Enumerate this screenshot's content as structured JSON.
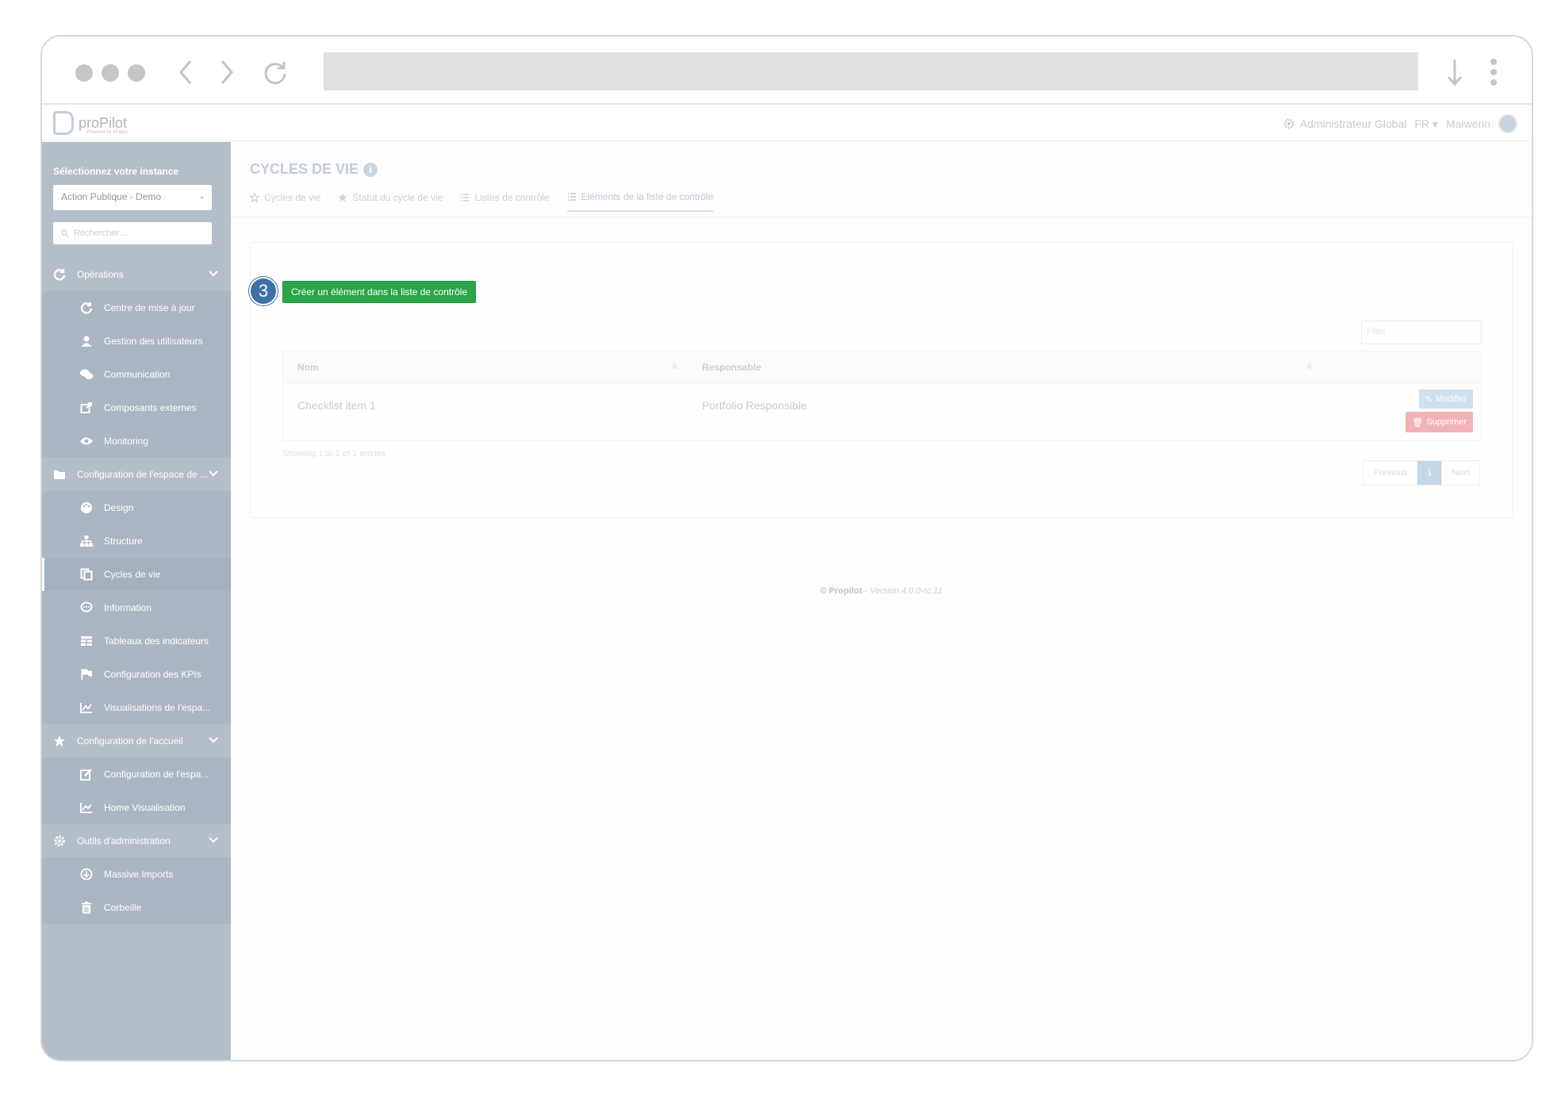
{
  "app": {
    "logo_text": "proPilot",
    "logo_sub": "Powered by eFakta"
  },
  "topbar": {
    "role": "Administrateur Global",
    "lang": "FR",
    "user": "Maiwenn"
  },
  "sidebar": {
    "instance_title": "Sélectionnez votre instance",
    "instance_value": "Action Publique - Demo",
    "search_placeholder": "Rechercher ...",
    "items": [
      {
        "label": "Opérations",
        "type": "section",
        "icon": "refresh-icon"
      },
      {
        "label": "Centre de mise à jour",
        "type": "child",
        "icon": "refresh-icon"
      },
      {
        "label": "Gestion des utilisateurs",
        "type": "child",
        "icon": "user-icon"
      },
      {
        "label": "Communication",
        "type": "child",
        "icon": "comments-icon"
      },
      {
        "label": "Composants externes",
        "type": "child",
        "icon": "share-icon"
      },
      {
        "label": "Monitoring",
        "type": "child",
        "icon": "eye-icon"
      },
      {
        "label": "Configuration de l'espace de ...",
        "type": "section",
        "icon": "folder-icon"
      },
      {
        "label": "Design",
        "type": "child",
        "icon": "palette-icon"
      },
      {
        "label": "Structure",
        "type": "child",
        "icon": "sitemap-icon"
      },
      {
        "label": "Cycles de vie",
        "type": "child",
        "icon": "copy-icon",
        "active": true
      },
      {
        "label": "Information",
        "type": "child",
        "icon": "comment-icon"
      },
      {
        "label": "Tableaux des indicateurs",
        "type": "child",
        "icon": "table-icon"
      },
      {
        "label": "Configuration des KPIs",
        "type": "child",
        "icon": "flag-icon"
      },
      {
        "label": "Visualisations de l'espa...",
        "type": "child",
        "icon": "chart-icon"
      },
      {
        "label": "Configuration de l'accueil",
        "type": "section",
        "icon": "star-icon"
      },
      {
        "label": "Configuration de l'espa...",
        "type": "child",
        "icon": "edit-icon"
      },
      {
        "label": "Home Visualisation",
        "type": "child",
        "icon": "chart-icon"
      },
      {
        "label": "Outils d'administration",
        "type": "section",
        "icon": "gear-icon"
      },
      {
        "label": "Massive Imports",
        "type": "child",
        "icon": "download-circle-icon"
      },
      {
        "label": "Corbeille",
        "type": "child",
        "icon": "trash-icon"
      }
    ]
  },
  "main": {
    "title": "CYCLES DE VIE",
    "tabs": [
      {
        "label": "Cycles de vie",
        "icon": "star-outline-icon"
      },
      {
        "label": "Statut du cycle de vie",
        "icon": "star-icon"
      },
      {
        "label": "Listes de contrôle",
        "icon": "list-icon"
      },
      {
        "label": "Eléments de la liste de contrôle",
        "icon": "list-icon",
        "active": true
      }
    ],
    "step_number": "3",
    "create_button": "Créer un élément dans la liste de contrôle",
    "filter_placeholder": "Filter",
    "table": {
      "columns": [
        "Nom",
        "Responsable"
      ],
      "rows": [
        {
          "name": "Checklist item 1",
          "responsible": "Portfolio Responsible",
          "edit": "Modifier",
          "delete": "Supprimer"
        }
      ]
    },
    "showing": "Showing 1 to 1 of 1 entries",
    "pager": {
      "previous": "Previous",
      "current": "1",
      "next": "Next"
    }
  },
  "footer": {
    "brand": "© Propilot",
    "sep": " - ",
    "version": "Version 4.0.0-rc.11"
  }
}
